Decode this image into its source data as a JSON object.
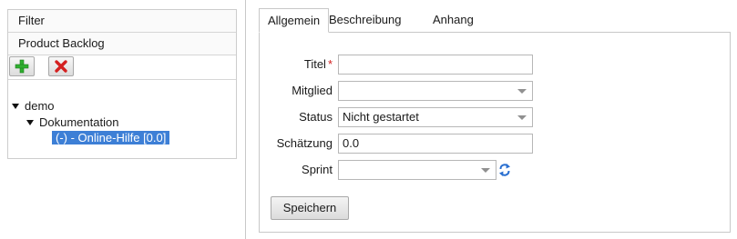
{
  "left": {
    "filter_label": "Filter",
    "backlog_label": "Product Backlog",
    "toolbar": {
      "add_icon": "add-plus-icon",
      "delete_icon": "delete-x-icon"
    },
    "tree": {
      "root": "demo",
      "child": "Dokumentation",
      "leaf": "(-) - Online-Hilfe [0.0]"
    }
  },
  "tabs": [
    "Allgemein",
    "Beschreibung",
    "Anhang"
  ],
  "form": {
    "title_label": "Titel",
    "required_marker": "*",
    "title_value": "",
    "member_label": "Mitglied",
    "member_value": "",
    "status_label": "Status",
    "status_value": "Nicht gestartet",
    "estimate_label": "Schätzung",
    "estimate_value": "0.0",
    "sprint_label": "Sprint",
    "sprint_value": "",
    "save_label": "Speichern"
  },
  "colors": {
    "selection": "#3d7fd6",
    "required": "#d21d1d",
    "add_green": "#2fae2f",
    "delete_red": "#d42020",
    "refresh_blue": "#2a6fd0"
  }
}
